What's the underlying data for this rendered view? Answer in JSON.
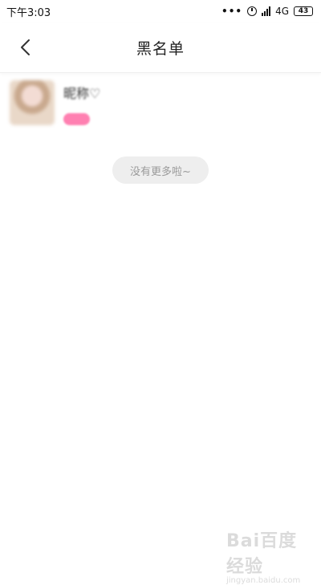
{
  "status_bar": {
    "time": "下午3:03",
    "network": "4G",
    "battery": "43",
    "icons": [
      "more-dots-icon",
      "alarm-icon",
      "signal-icon",
      "battery-icon"
    ]
  },
  "header": {
    "title": "黑名单",
    "back_icon": "chevron-left-icon"
  },
  "blacklist": {
    "items": [
      {
        "name": "昵称♡",
        "tag": ""
      }
    ]
  },
  "footer": {
    "no_more": "没有更多啦~"
  },
  "watermark": {
    "brand": "Bai百度经验",
    "url": "jingyan.baidu.com"
  }
}
